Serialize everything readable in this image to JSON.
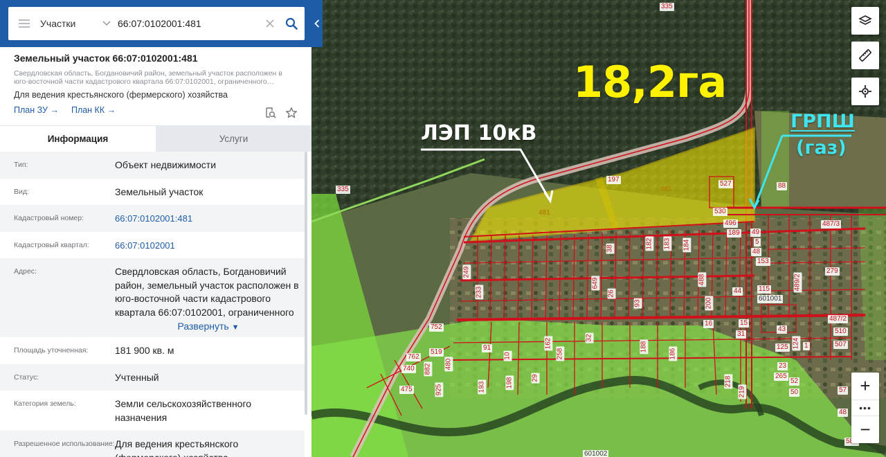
{
  "search": {
    "type_label": "Участки",
    "query": "66:07:0102001:481"
  },
  "object": {
    "title": "Земельный участок 66:07:0102001:481",
    "description": "Свердловская область, Богдановичий район, земельный участок расположен в юго-восточной части кадастрового квартала 66:07:0102001, ограниченного…",
    "purpose": "Для ведения крестьянского (фермерского) хозяйства",
    "links": [
      "План ЗУ",
      "План КК"
    ],
    "link_arrow": "→"
  },
  "tabs": [
    "Информация",
    "Услуги"
  ],
  "info": {
    "type": {
      "label": "Тип:",
      "value": "Объект недвижимости"
    },
    "kind": {
      "label": "Вид:",
      "value": "Земельный участок"
    },
    "cadnum": {
      "label": "Кадастровый номер:",
      "value": "66:07:0102001:481"
    },
    "quarter": {
      "label": "Кадастровый квартал:",
      "value": "66:07:0102001"
    },
    "address": {
      "label": "Адрес:",
      "value": "Свердловская область, Богдановичий район, земельный участок расположен в юго-восточной части кадастрового квартала 66:07:0102001, ограниченного"
    },
    "expand": "Развернуть",
    "area": {
      "label": "Площадь уточненная:",
      "value": "181 900 кв. м"
    },
    "status": {
      "label": "Статус:",
      "value": "Учтенный"
    },
    "category": {
      "label": "Категория земель:",
      "value": "Земли сельскохозяйственного назначения"
    },
    "usage": {
      "label": "Разрешенное использование:",
      "value": "Для ведения крестьянского (фермерского) хозяйства"
    }
  },
  "map": {
    "annotations": {
      "area": "18,2га",
      "lep": "ЛЭП 10кВ",
      "grpsh": "ГРПШ",
      "gas": "(газ)"
    },
    "plot_numbers": [
      "335",
      "335",
      "197",
      "481",
      "481",
      "527",
      "88",
      "530",
      "496",
      "189",
      "49",
      "5",
      "48",
      "153",
      "487/3",
      "38",
      "182",
      "183",
      "184",
      "488",
      "279",
      "249",
      "649",
      "26",
      "93",
      "200",
      "44",
      "115",
      "489/2",
      "233",
      "601001",
      "752",
      "32",
      "487/2",
      "16",
      "15",
      "31",
      "43",
      "510",
      "507",
      "91",
      "162",
      "188",
      "186",
      "125",
      "124",
      "1",
      "519",
      "762",
      "10",
      "258",
      "740",
      "882",
      "480",
      "23",
      "265",
      "52",
      "50",
      "57",
      "475",
      "925",
      "193",
      "198",
      "29",
      "219",
      "218",
      "48",
      "601002",
      "583"
    ],
    "zoom_in": "+",
    "zoom_more": "•••",
    "zoom_out": "−"
  },
  "colors": {
    "brand_blue": "#1f5ca8",
    "highlight_yellow": "#fff200",
    "cyan_annotation": "#3fe4ef",
    "boundary_red": "#d0101a",
    "zone_green": "#7ddc3c"
  }
}
